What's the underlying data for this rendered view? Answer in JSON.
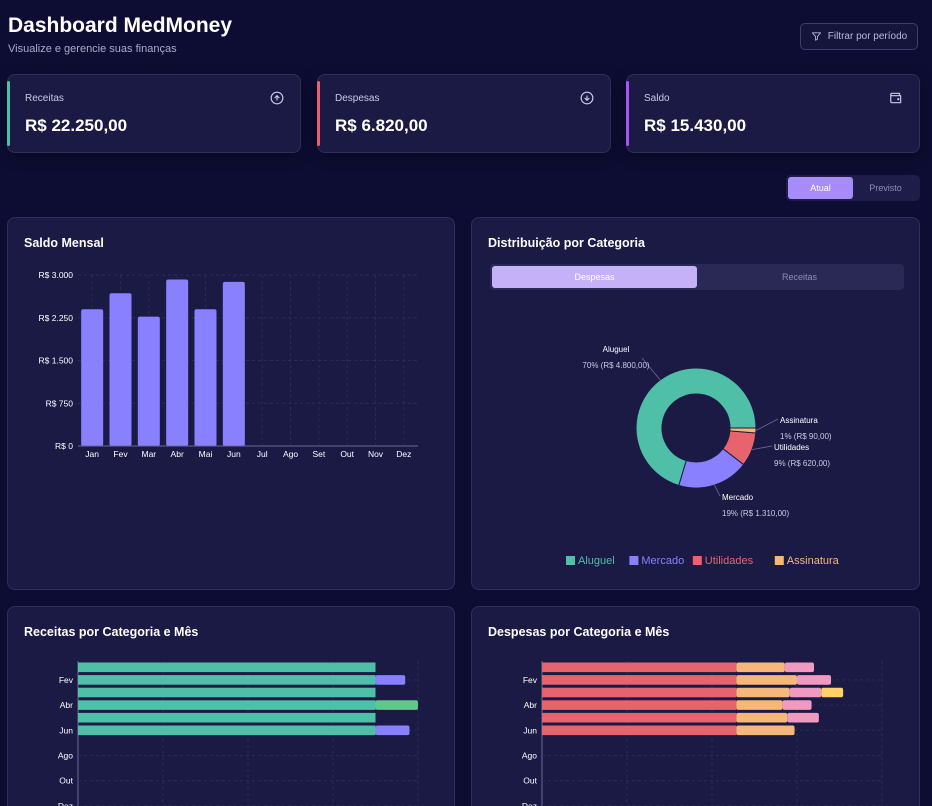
{
  "header": {
    "title": "Dashboard MedMoney",
    "subtitle": "Visualize e gerencie suas finanças",
    "filter_label": "Filtrar por período"
  },
  "cards": [
    {
      "label": "Receitas",
      "value": "R$ 22.250,00",
      "accent": "#4fbfa8",
      "icon": "arrow-up-circle-icon"
    },
    {
      "label": "Despesas",
      "value": "R$ 6.820,00",
      "accent": "#e7646f",
      "icon": "arrow-down-circle-icon"
    },
    {
      "label": "Saldo",
      "value": "R$ 15.430,00",
      "accent": "#a855f7",
      "icon": "wallet-icon"
    }
  ],
  "period_toggle": {
    "options": [
      "Atual",
      "Previsto"
    ],
    "selected": "Atual"
  },
  "colors": {
    "accent": "#a78bfa",
    "bar": "#8880ff",
    "aluguel": "#4fbfa8",
    "mercado": "#8880ff",
    "utilidades": "#e7646f",
    "assinatura": "#f5b87a",
    "pink": "#f19ac1",
    "yellow": "#ffd067",
    "green": "#5fc88a"
  },
  "saldo_mensal": {
    "title": "Saldo Mensal",
    "chart_data": {
      "type": "bar",
      "categories": [
        "Jan",
        "Fev",
        "Mar",
        "Abr",
        "Mai",
        "Jun",
        "Jul",
        "Ago",
        "Set",
        "Out",
        "Nov",
        "Dez"
      ],
      "values": [
        2400,
        2680,
        2270,
        2920,
        2400,
        2880,
        0,
        0,
        0,
        0,
        0,
        0
      ],
      "ylim": [
        0,
        3000
      ],
      "yticks": [
        0,
        750,
        1500,
        2250,
        3000
      ],
      "ytick_labels": [
        "R$ 0",
        "R$ 750",
        "R$ 1.500",
        "R$ 2.250",
        "R$ 3.000"
      ],
      "grid": true
    }
  },
  "distribuicao": {
    "title": "Distribuição por Categoria",
    "tabs": [
      "Despesas",
      "Receitas"
    ],
    "selected_tab": "Despesas",
    "chart_data": {
      "type": "pie",
      "donut": true,
      "slices": [
        {
          "name": "Aluguel",
          "value": 4800,
          "label_pct": "70% (R$ 4.800,00)"
        },
        {
          "name": "Mercado",
          "value": 1310,
          "label_pct": "19% (R$ 1.310,00)"
        },
        {
          "name": "Utilidades",
          "value": 620,
          "label_pct": "9% (R$ 620,00)"
        },
        {
          "name": "Assinatura",
          "value": 90,
          "label_pct": "1% (R$ 90,00)"
        }
      ],
      "legend": [
        "Aluguel",
        "Mercado",
        "Utilidades",
        "Assinatura"
      ]
    }
  },
  "receitas_categoria": {
    "title": "Receitas por Categoria e Mês",
    "chart_data": {
      "type": "bar",
      "orientation": "horizontal",
      "stacked": true,
      "categories": [
        "Jan",
        "Fev",
        "Mar",
        "Abr",
        "Mai",
        "Jun",
        "Jul",
        "Ago",
        "Set",
        "Out",
        "Nov",
        "Dez"
      ],
      "visible_tick_labels": [
        "Fev",
        "Abr",
        "Jun",
        "Ago",
        "Out",
        "Dez"
      ],
      "series": [
        {
          "color": "#4fbfa8",
          "values": [
            3500,
            3500,
            3500,
            3500,
            3500,
            3500,
            0,
            0,
            0,
            0,
            0,
            0
          ]
        },
        {
          "color": "#8880ff",
          "values": [
            0,
            350,
            0,
            0,
            0,
            400,
            0,
            0,
            0,
            0,
            0,
            0
          ]
        },
        {
          "color": "#5fc88a",
          "values": [
            0,
            0,
            0,
            500,
            0,
            0,
            0,
            0,
            0,
            0,
            0,
            0
          ]
        }
      ],
      "xlim": [
        0,
        4000
      ]
    }
  },
  "despesas_categoria": {
    "title": "Despesas por Categoria e Mês",
    "chart_data": {
      "type": "bar",
      "orientation": "horizontal",
      "stacked": true,
      "categories": [
        "Jan",
        "Fev",
        "Mar",
        "Abr",
        "Mai",
        "Jun",
        "Jul",
        "Ago",
        "Set",
        "Out",
        "Nov",
        "Dez"
      ],
      "visible_tick_labels": [
        "Fev",
        "Abr",
        "Jun",
        "Ago",
        "Out",
        "Dez"
      ],
      "series": [
        {
          "color": "#e7646f",
          "values": [
            800,
            800,
            800,
            800,
            800,
            800,
            0,
            0,
            0,
            0,
            0,
            0
          ]
        },
        {
          "color": "#f5b87a",
          "values": [
            200,
            250,
            220,
            190,
            210,
            240,
            0,
            0,
            0,
            0,
            0,
            0
          ]
        },
        {
          "color": "#f19ac1",
          "values": [
            120,
            140,
            130,
            120,
            130,
            0,
            0,
            0,
            0,
            0,
            0,
            0
          ]
        },
        {
          "color": "#ffd067",
          "values": [
            0,
            0,
            90,
            0,
            0,
            0,
            0,
            0,
            0,
            0,
            0,
            0
          ]
        }
      ],
      "xlim": [
        0,
        1400
      ]
    }
  }
}
